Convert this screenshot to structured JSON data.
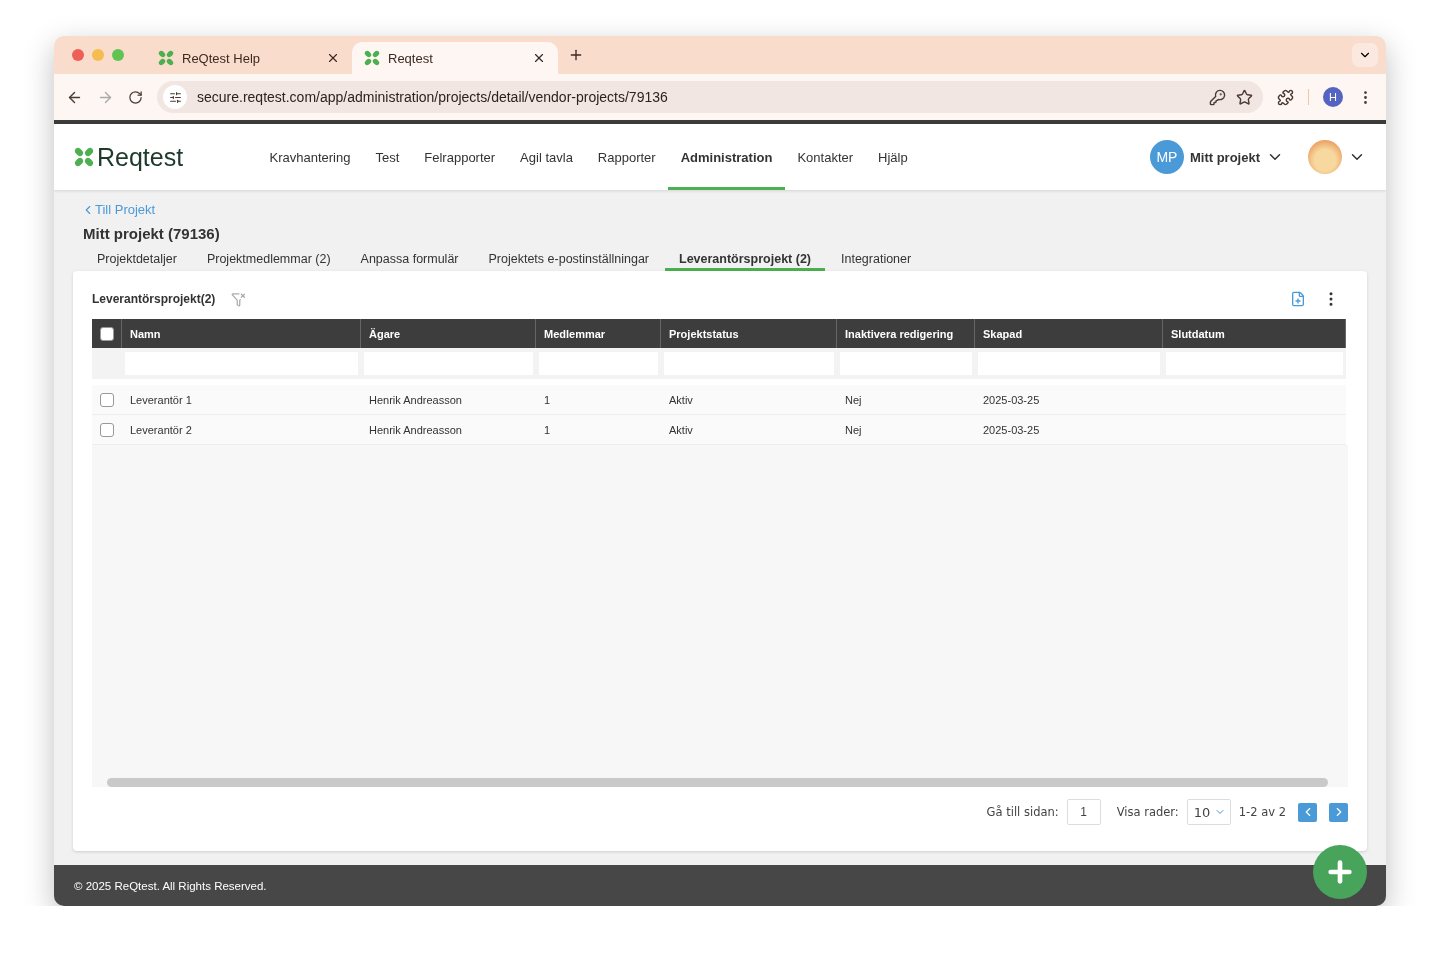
{
  "browser": {
    "tabs": [
      {
        "title": "ReQtest Help",
        "selected": false
      },
      {
        "title": "Reqtest",
        "selected": true
      }
    ],
    "url": "secure.reqtest.com/app/administration/projects/detail/vendor-projects/79136",
    "profile_initial": "H"
  },
  "app": {
    "logo": "Reqtest",
    "nav": [
      {
        "label": "Kravhantering",
        "selected": false
      },
      {
        "label": "Test",
        "selected": false
      },
      {
        "label": "Felrapporter",
        "selected": false
      },
      {
        "label": "Agil tavla",
        "selected": false
      },
      {
        "label": "Rapporter",
        "selected": false
      },
      {
        "label": "Administration",
        "selected": true
      },
      {
        "label": "Kontakter",
        "selected": false
      },
      {
        "label": "Hjälp",
        "selected": false
      }
    ],
    "project": {
      "initials": "MP",
      "name": "Mitt projekt"
    }
  },
  "back_link": "Till Projekt",
  "page_title": "Mitt projekt (79136)",
  "tabs": [
    {
      "label": "Projektdetaljer",
      "selected": false
    },
    {
      "label": "Projektmedlemmar (2)",
      "selected": false
    },
    {
      "label": "Anpassa formulär",
      "selected": false
    },
    {
      "label": "Projektets e-postinställningar",
      "selected": false
    },
    {
      "label": "Leverantörsprojekt (2)",
      "selected": true
    },
    {
      "label": "Integrationer",
      "selected": false
    }
  ],
  "table": {
    "title": "Leverantörsprojekt(2)",
    "all_checked": false,
    "columns": [
      "Namn",
      "Ägare",
      "Medlemmar",
      "Projektstatus",
      "Inaktivera redigering",
      "Skapad",
      "Slutdatum"
    ],
    "rows": [
      {
        "checked": false,
        "cells": [
          "Leverantör 1",
          "Henrik Andreasson",
          "1",
          "Aktiv",
          "Nej",
          "2025-03-25",
          ""
        ]
      },
      {
        "checked": false,
        "cells": [
          "Leverantör 2",
          "Henrik Andreasson",
          "1",
          "Aktiv",
          "Nej",
          "2025-03-25",
          ""
        ]
      }
    ]
  },
  "pagination": {
    "goto_label": "Gå till sidan:",
    "page": "1",
    "rows_label": "Visa rader:",
    "rows_per_page": "10",
    "range": "1-2 av 2"
  },
  "footer": "© 2025 ReQtest. All Rights Reserved."
}
